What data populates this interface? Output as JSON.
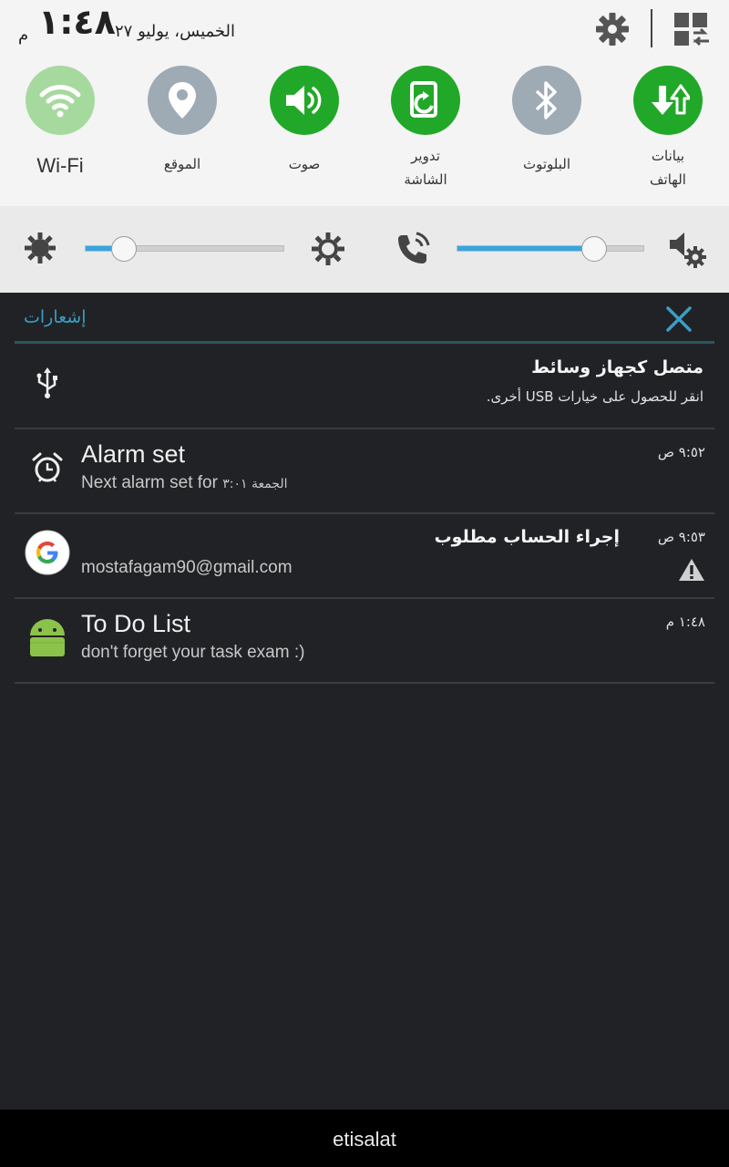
{
  "status": {
    "time": "١:٤٨",
    "ampm": "م",
    "date": "الخميس، يوليو ٢٧"
  },
  "quick_tiles": [
    {
      "label": "Wi-Fi",
      "icon": "wifi-icon",
      "state": "on",
      "color": "#a6d99e"
    },
    {
      "label": "الموقع",
      "icon": "location-icon",
      "state": "off",
      "color": "#9eaab4"
    },
    {
      "label": "صوت",
      "icon": "sound-icon",
      "state": "on",
      "color": "#22a829"
    },
    {
      "label": "تدوير الشاشة",
      "label_line1": "تدوير",
      "label_line2": "الشاشة",
      "icon": "rotate-icon",
      "state": "on",
      "color": "#22a829"
    },
    {
      "label": "البلوتوث",
      "icon": "bluetooth-icon",
      "state": "off",
      "color": "#9eaab4"
    },
    {
      "label": "بيانات الهاتف",
      "label_line1": "بيانات",
      "label_line2": "الهاتف",
      "icon": "mobile-data-icon",
      "state": "on",
      "color": "#22a829"
    }
  ],
  "sliders": {
    "brightness_level": 0.19,
    "volume_level": 0.73,
    "accent": "#35a6e0"
  },
  "notifications_header": {
    "title": "إشعارات"
  },
  "notifications": [
    {
      "icon": "usb-icon",
      "title": "متصل كجهاز وسائط",
      "subtitle": "انقر للحصول على خيارات USB أخرى."
    },
    {
      "icon": "alarm-icon",
      "title": "Alarm set",
      "subtitle": "Next alarm set for",
      "subtitle_ar": "الجمعة ٣:٠١",
      "time": "٩:٥٢ ص"
    },
    {
      "icon": "google-icon",
      "title": "إجراء الحساب مطلوب",
      "subtitle": "mostafagam90@gmail.com",
      "time": "٩:٥٣ ص",
      "badge_icon": "warning-icon"
    },
    {
      "icon": "android-icon",
      "title": "To Do List",
      "subtitle": "don't forget your task exam :)",
      "time": "١:٤٨ م"
    }
  ],
  "carrier": "etisalat"
}
